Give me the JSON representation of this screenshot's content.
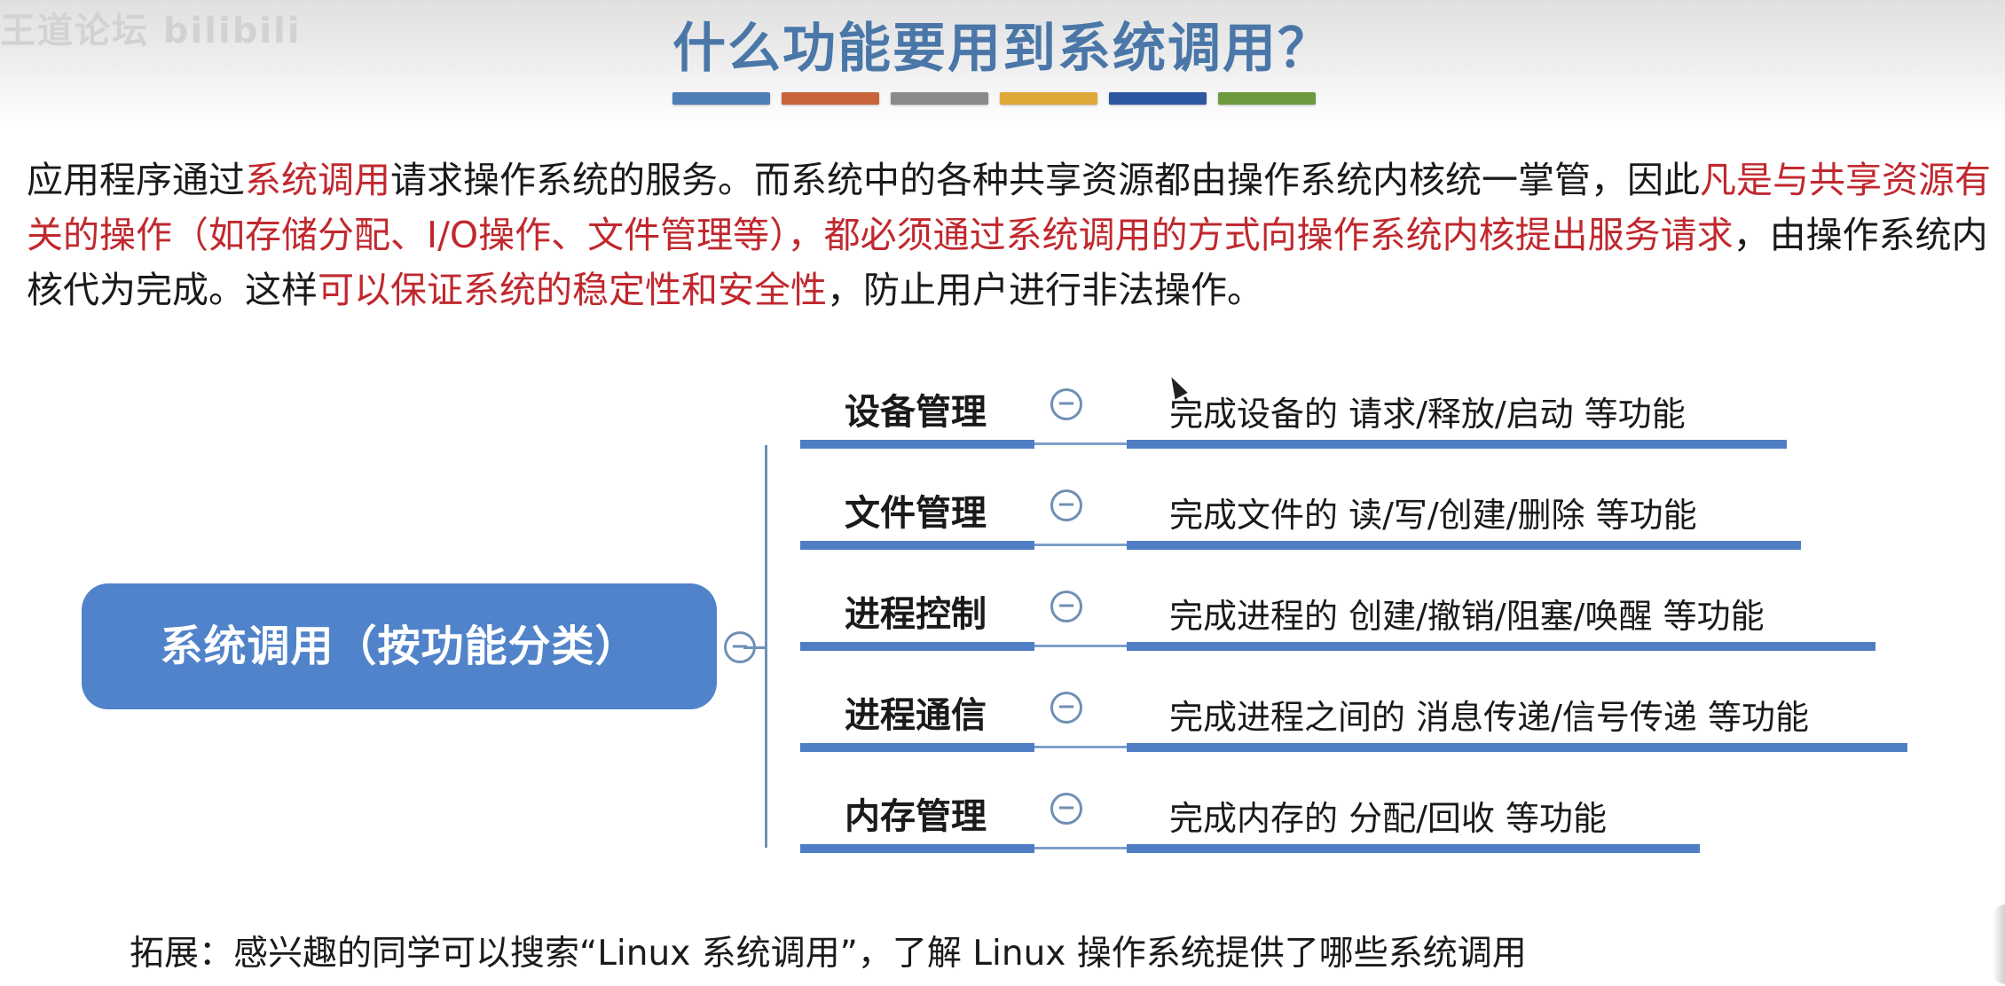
{
  "watermark": "王道论坛 bilibili",
  "slide_title": "什么功能要用到系统调用？",
  "title_bar_colors": [
    "#4f7fb8",
    "#c8653a",
    "#8a8a8a",
    "#e0a93a",
    "#2d57a0",
    "#6d9a3e"
  ],
  "intro": {
    "p1": "应用程序通过",
    "h1": "系统调用",
    "p2": "请求操作系统的服务。而系统中的各种共享资源都由操作系统内核统一掌管，因此",
    "h2": "凡是与共享资源有关的操作（如存储分配、I/O操作、文件管理等），都必须通过系统调用的方式向操作系统内核提出服务请求",
    "p3": "，由操作系统内核代为完成。这样",
    "h3": "可以保证系统的稳定性和安全性",
    "p4": "，防止用户进行非法操作。"
  },
  "mindmap": {
    "root_label": "系统调用（按功能分类）",
    "collapse_symbol": "−",
    "branches": [
      {
        "category": "设备管理",
        "description": "完成设备的 请求/释放/启动 等功能"
      },
      {
        "category": "文件管理",
        "description": "完成文件的 读/写/创建/删除 等功能"
      },
      {
        "category": "进程控制",
        "description": "完成进程的 创建/撤销/阻塞/唤醒 等功能"
      },
      {
        "category": "进程通信",
        "description": "完成进程之间的 消息传递/信号传递 等功能"
      },
      {
        "category": "内存管理",
        "description": "完成内存的 分配/回收 等功能"
      }
    ]
  },
  "footer": "拓展：感兴趣的同学可以搜索“Linux 系统调用”，了解 Linux 操作系统提供了哪些系统调用",
  "colors": {
    "title": "#4a77a8",
    "highlight": "#c0282e",
    "node_fill": "#5083c9",
    "branch_line": "#4f7ec4"
  }
}
